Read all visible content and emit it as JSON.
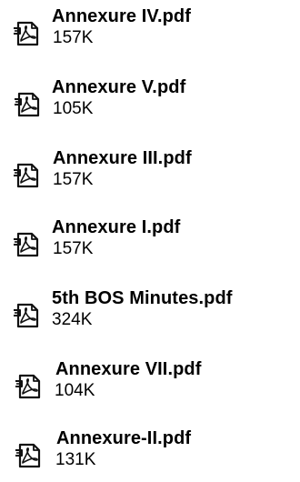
{
  "files": [
    {
      "name": "Annexure IV.pdf",
      "size": "157K",
      "icon": "pdf-file-icon"
    },
    {
      "name": "Annexure V.pdf",
      "size": "105K",
      "icon": "pdf-file-icon"
    },
    {
      "name": "Annexure III.pdf",
      "size": "157K",
      "icon": "pdf-file-icon"
    },
    {
      "name": "Annexure I.pdf",
      "size": "157K",
      "icon": "pdf-file-icon"
    },
    {
      "name": "5th BOS Minutes.pdf",
      "size": "324K",
      "icon": "pdf-file-icon"
    },
    {
      "name": "Annexure VII.pdf",
      "size": "104K",
      "icon": "pdf-file-icon"
    },
    {
      "name": "Annexure-II.pdf",
      "size": "131K",
      "icon": "pdf-file-icon"
    }
  ]
}
